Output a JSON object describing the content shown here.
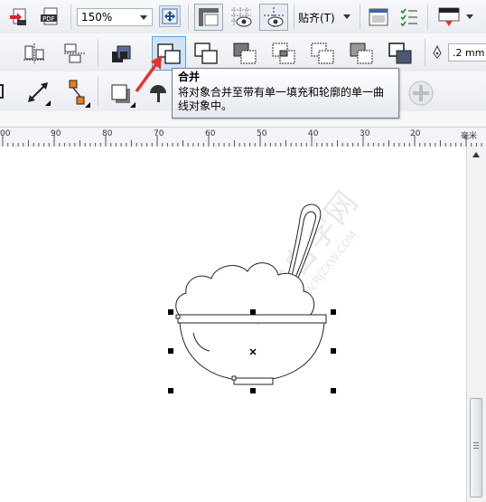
{
  "toolbar_top": {
    "zoom_value": "150%",
    "snap_label": "贴齐(T)",
    "icons": [
      "import-icon",
      "export-pdf-icon",
      "zoom-select",
      "pan-icon",
      "rulers-icon",
      "grid-icon",
      "guidelines-icon",
      "snap-dropdown",
      "options-icon",
      "settings-icon",
      "color-icon"
    ]
  },
  "toolbar_shaping": {
    "outline_width": ".2 mm",
    "icons": [
      "align-icon",
      "distribute-icon",
      "arrange-icon",
      "combine-icon",
      "weld-icon",
      "trim-icon",
      "intersect-icon",
      "simplify-icon",
      "front-minus-back-icon",
      "back-minus-front-icon",
      "boundary-icon"
    ]
  },
  "tooltip": {
    "title": "合并",
    "body": "将对象合并至带有单一填充和轮廓的单一曲线对象中。"
  },
  "ruler": {
    "unit": "毫米",
    "labels": [
      "00",
      "90",
      "80",
      "70",
      "60",
      "50",
      "40",
      "30",
      "20"
    ]
  },
  "watermark": {
    "text": "软件自学网",
    "url": "WWW.RJZXW.COM"
  },
  "colors": {
    "accent_red": "#e8322d",
    "selected_button": "#cfe3f7"
  }
}
